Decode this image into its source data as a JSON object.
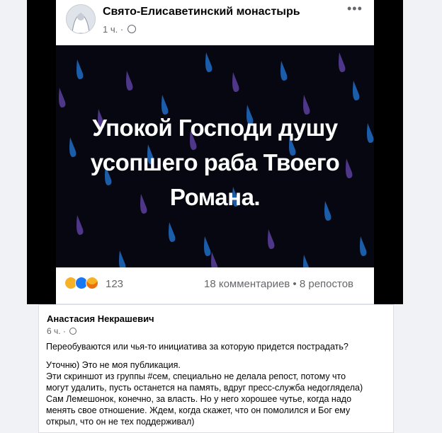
{
  "post": {
    "page_name": "Свято-Елисаветинский монастырь",
    "time": "1 ч. ·",
    "more_icon": "more-icon",
    "image_text": {
      "line1": "Упокой Господи душу",
      "line2": "усопшего раба Твоего",
      "line3": "Романа."
    },
    "reactions": {
      "icons": [
        "sad-emoji-icon",
        "like-icon",
        "care-emoji-icon"
      ],
      "count": "123"
    },
    "stats": "18 комментариев • 8 репостов",
    "colors": {
      "like": "#1877f2",
      "sad": "#f7b125",
      "rain_blue": "#1f6cc4",
      "rain_purple": "#5b3f9e"
    }
  },
  "comment": {
    "author": "Анастасия Некрашевич",
    "time": "6 ч. ·",
    "lines": [
      "Переобуваются или чья-то инициатива за которую придется пострадать?",
      "Уточню) Это не моя публикация.",
      "Эти скриншот из группы #сем, специально не делала репост, потому что",
      "могут удалить, пусть останется на память, вдруг пресс-служба недоглядела)",
      "Сам Лемешонок, конечно, за власть. Но у него хорошее чутье, когда надо",
      "менять свое отношение. Ждем, когда скажет, что он помолился и Бог ему",
      "открыл, что он не тех поддерживал)"
    ]
  }
}
